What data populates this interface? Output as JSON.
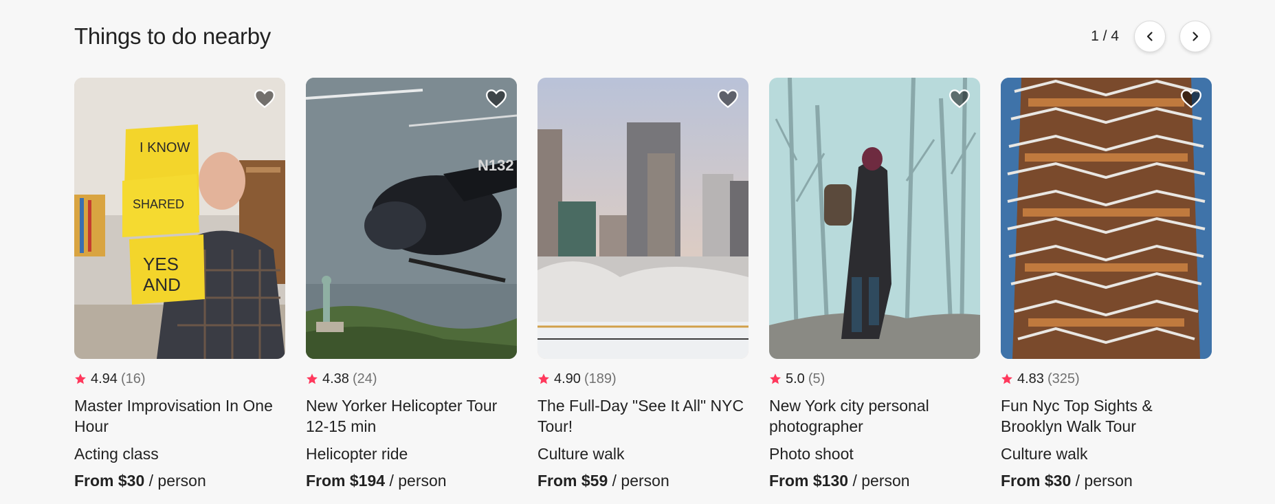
{
  "section": {
    "title": "Things to do nearby",
    "page_indicator": "1 / 4",
    "prev_icon": "chevron-left-icon",
    "next_icon": "chevron-right-icon"
  },
  "colors": {
    "star": "#ff385c",
    "text": "#222222",
    "muted": "#717171",
    "background": "#f7f7f7"
  },
  "cards": [
    {
      "rating": "4.94",
      "reviews": "(16)",
      "title": "Master Improvisation In One Hour",
      "category": "Acting class",
      "price": "From $30",
      "unit": "/ person"
    },
    {
      "rating": "4.38",
      "reviews": "(24)",
      "title": "New Yorker Helicopter Tour 12-15 min",
      "category": "Helicopter ride",
      "price": "From $194",
      "unit": "/ person"
    },
    {
      "rating": "4.90",
      "reviews": "(189)",
      "title": "The Full-Day \"See It All\" NYC Tour!",
      "category": "Culture walk",
      "price": "From $59",
      "unit": "/ person"
    },
    {
      "rating": "5.0",
      "reviews": "(5)",
      "title": "New York city personal photographer",
      "category": "Photo shoot",
      "price": "From $130",
      "unit": "/ person"
    },
    {
      "rating": "4.83",
      "reviews": "(325)",
      "title": "Fun Nyc Top Sights & Brooklyn Walk Tour",
      "category": "Culture walk",
      "price": "From $30",
      "unit": "/ person"
    }
  ]
}
